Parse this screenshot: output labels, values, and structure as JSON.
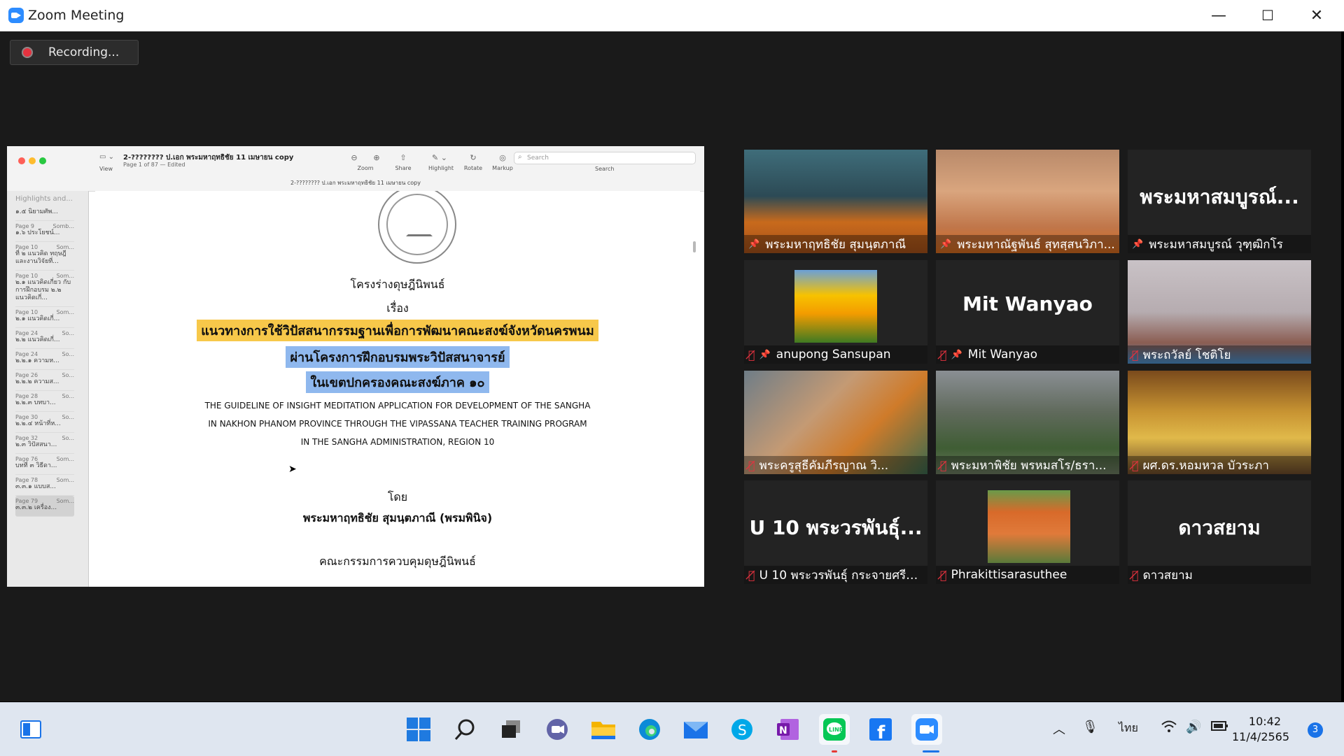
{
  "window": {
    "title": "Zoom Meeting",
    "minimize": "—",
    "maximize": "☐",
    "close": "✕"
  },
  "recording": {
    "label": "Recording..."
  },
  "shared_doc": {
    "title": "2-???????? ป.เอก พระมหาฤทธิชัย 11 เมษายน copy",
    "subtitle": "Page 1 of 87 — Edited",
    "caption": "2-???????? ป.เอก พระมหาฤทธิชัย 11 เมษายน copy",
    "view_label": "View",
    "tools": [
      "Zoom",
      "Share",
      "Highlight",
      "Rotate",
      "Markup"
    ],
    "search_placeholder": "Search",
    "search_label": "Search",
    "sidebar_header": "Highlights and...",
    "sidebar_items": [
      {
        "page": "",
        "author": "",
        "text": "๑.๕ นิยามศัพ..."
      },
      {
        "page": "Page 9",
        "author": "Somb...",
        "text": "๑.๖ ประโยชน์..."
      },
      {
        "page": "Page 10",
        "author": "Som...",
        "text": "ที่ ๒ แนวคิด ทฤษฎี และงานวิจัยที่..."
      },
      {
        "page": "Page 10",
        "author": "Som...",
        "text": "๒.๑ แนวคิดเกี่ยว กับการฝึกอบรม ๒.๒ แนวคิดเกี่..."
      },
      {
        "page": "Page 10",
        "author": "Som...",
        "text": "๒.๑ แนวคิดเกี่..."
      },
      {
        "page": "Page 24",
        "author": "So...",
        "text": "๒.๒ แนวคิดเกี่..."
      },
      {
        "page": "Page 24",
        "author": "So...",
        "text": "๒.๒.๑ ความห..."
      },
      {
        "page": "Page 26",
        "author": "So...",
        "text": "๒.๒.๒ ความส..."
      },
      {
        "page": "Page 28",
        "author": "So...",
        "text": "๒.๒.๓ บทบา..."
      },
      {
        "page": "Page 30",
        "author": "So...",
        "text": "๒.๒.๔ หน้าที่ห..."
      },
      {
        "page": "Page 32",
        "author": "So...",
        "text": "๒.๓ วิปัสสนา..."
      },
      {
        "page": "Page 76",
        "author": "Som...",
        "text": "บทที่ ๓ วิธีดา..."
      },
      {
        "page": "Page 78",
        "author": "Som...",
        "text": "๓.๓.๑ แบบส..."
      },
      {
        "page": "Page 79",
        "author": "Som...",
        "text": "๓.๓.๒ เครื่อง..."
      }
    ],
    "lines": {
      "l1": "โครงร่างดุษฎีนิพนธ์",
      "l2": "เรื่อง",
      "h1": "แนวทางการใช้วิปัสสนากรรมฐานเพื่อการพัฒนาคณะสงฆ์จังหวัดนครพนม",
      "h2": "ผ่านโครงการฝึกอบรมพระวิปัสสนาจารย์",
      "h3": "ในเขตปกครองคณะสงฆ์ภาค ๑๐",
      "e1": "THE GUIDELINE OF INSIGHT MEDITATION APPLICATION FOR DEVELOPMENT  OF THE  SANGHA",
      "e2": "IN NAKHON PHANOM PROVINCE THROUGH THE VIPASSANA TEACHER TRAINING PROGRAM",
      "e3": "IN THE SANGHA ADMINISTRATION, REGION 10",
      "by": "โดย",
      "author": "พระมหาฤทธิชัย  สุมนฺตภาณี (พรมพินิจ)",
      "committee": "คณะกรรมการควบคุมดุษฎีนิพนธ์"
    },
    "colors": {
      "hl_yellow": "#f7c84a",
      "hl_blue": "#8fb8ee"
    }
  },
  "participants": [
    {
      "name": "พระมหาฤทธิชัย สุมนฺตภาณี",
      "muted": false,
      "pinned": true,
      "video": "monk-orange",
      "big": ""
    },
    {
      "name": "พระมหาณัฐพันธ์ สุทสฺสนวิภา...",
      "muted": false,
      "pinned": true,
      "video": "man-face",
      "big": ""
    },
    {
      "name": "พระมหาสมบูรณ์ วุฑฺฒิกโร",
      "muted": false,
      "pinned": true,
      "video": "none",
      "big": "พระมหาสมบูรณ์...",
      "active": true
    },
    {
      "name": "anupong Sansupan",
      "muted": true,
      "pinned": true,
      "video": "tulips",
      "big": ""
    },
    {
      "name": "Mit Wanyao",
      "muted": true,
      "pinned": true,
      "video": "none",
      "big": "Mit Wanyao"
    },
    {
      "name": "พระถวัลย์ โชติโย",
      "muted": true,
      "pinned": false,
      "video": "ceiling",
      "big": ""
    },
    {
      "name": "พระครูสุธีคัมภีรญาณ วิ...",
      "muted": true,
      "pinned": false,
      "video": "monk-garden",
      "big": ""
    },
    {
      "name": "พระมหาพิชัย  พรหมสโร/ธรา...",
      "muted": true,
      "pinned": false,
      "video": "trees",
      "big": ""
    },
    {
      "name": "ผศ.ดร.หอมหวล บัวระภา",
      "muted": true,
      "pinned": false,
      "video": "temple",
      "big": ""
    },
    {
      "name": "U 10 พระวรพันธุ์ กระจายศรี ว...",
      "muted": true,
      "pinned": false,
      "video": "none",
      "big": "U 10 พระวรพันธุ์..."
    },
    {
      "name": "Phrakittisarasuthee",
      "muted": true,
      "pinned": false,
      "video": "sign",
      "big": ""
    },
    {
      "name": "ดาวสยาม",
      "muted": true,
      "pinned": false,
      "video": "none",
      "big": "ดาวสยาม"
    }
  ],
  "taskbar": {
    "lang": "ไทย",
    "time": "10:42",
    "date": "11/4/2565",
    "notifications": "3",
    "apps": [
      "start-icon",
      "search-icon",
      "task-view-icon",
      "chat-icon",
      "file-explorer-icon",
      "edge-icon",
      "mail-icon",
      "skype-icon",
      "onenote-icon",
      "line-icon",
      "facebook-icon",
      "zoom-icon"
    ]
  }
}
